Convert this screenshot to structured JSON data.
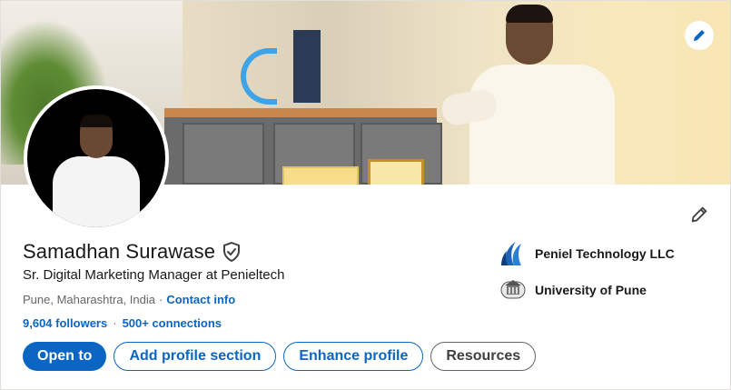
{
  "profile": {
    "name": "Samadhan Surawase",
    "headline": "Sr. Digital Marketing Manager at Penieltech",
    "location": "Pune, Maharashtra, India",
    "location_separator": "·",
    "contact_info": "Contact info",
    "followers": "9,604 followers",
    "stats_separator": "·",
    "connections": "500+ connections"
  },
  "actions": {
    "open_to": "Open to",
    "add_section": "Add profile section",
    "enhance": "Enhance profile",
    "resources": "Resources"
  },
  "organizations": [
    {
      "name": "Peniel Technology LLC",
      "icon": "peniel-logo-icon"
    },
    {
      "name": "University of Pune",
      "icon": "university-seal-icon"
    }
  ],
  "colors": {
    "accent": "#0a66c2",
    "text_primary": "#191919",
    "text_secondary": "#666666"
  }
}
